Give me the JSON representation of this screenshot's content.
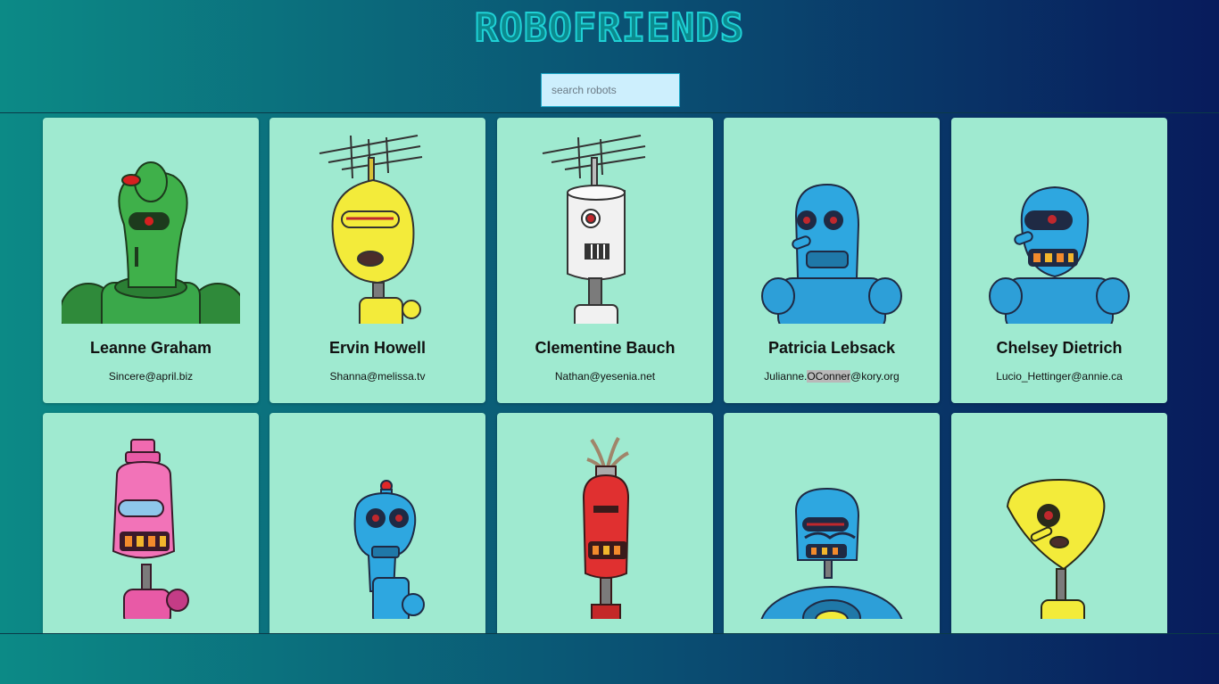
{
  "app": {
    "title": "ROBOFRIENDS"
  },
  "search": {
    "placeholder": "search robots",
    "value": ""
  },
  "robots": [
    {
      "name": "Leanne Graham",
      "email": "Sincere@april.biz",
      "icon": "green-robot"
    },
    {
      "name": "Ervin Howell",
      "email": "Shanna@melissa.tv",
      "icon": "yellow-antenna-robot"
    },
    {
      "name": "Clementine Bauch",
      "email": "Nathan@yesenia.net",
      "icon": "white-antenna-robot"
    },
    {
      "name": "Patricia Lebsack",
      "email_parts": [
        "Julianne.",
        "OConner",
        "@kory.org"
      ],
      "icon": "blue-robot"
    },
    {
      "name": "Chelsey Dietrich",
      "email": "Lucio_Hettinger@annie.ca",
      "icon": "blue-cyclops-robot"
    },
    {
      "name": "",
      "email": "",
      "icon": "pink-robot"
    },
    {
      "name": "",
      "email": "",
      "icon": "blue-robot-antenna-bulb"
    },
    {
      "name": "",
      "email": "",
      "icon": "red-robot"
    },
    {
      "name": "",
      "email": "",
      "icon": "blue-robot-mustache"
    },
    {
      "name": "",
      "email": "",
      "icon": "yellow-cyclops-robot"
    }
  ],
  "colors": {
    "card": "#9fead0",
    "title_fill": "#0b8a8e",
    "title_stroke": "#1fd1d6",
    "search_bg": "#cdeffd"
  }
}
